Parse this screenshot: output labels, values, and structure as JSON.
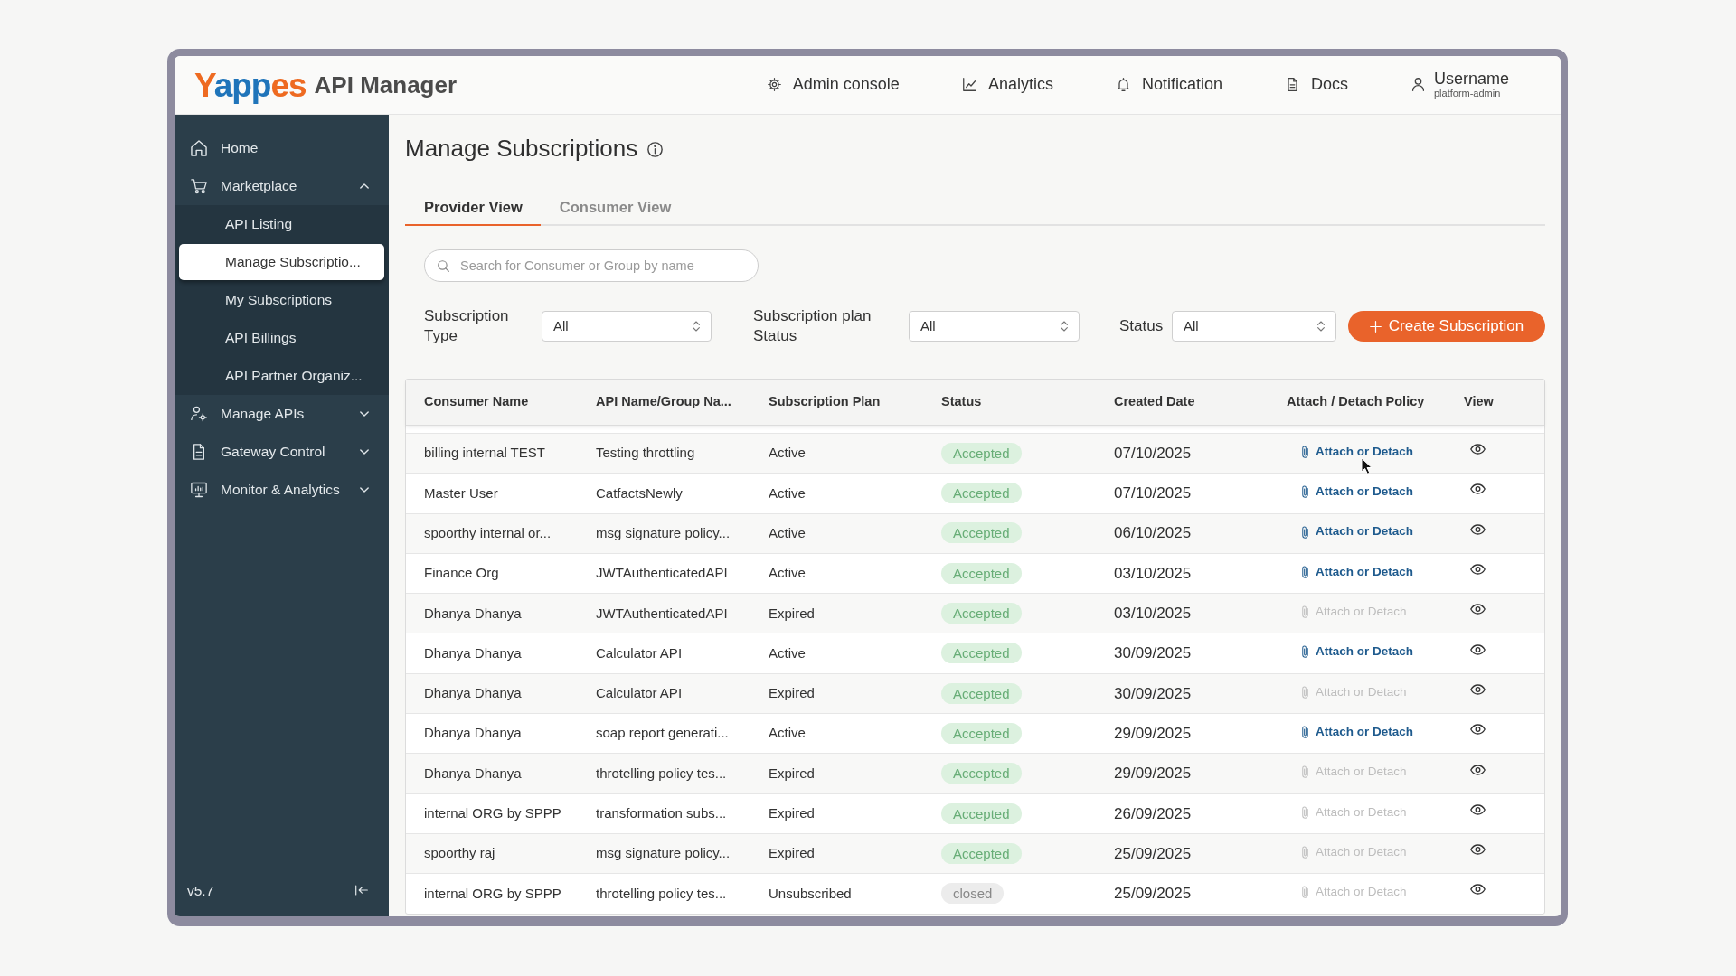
{
  "header": {
    "logo": "Yappes",
    "app_name": "API Manager",
    "nav": [
      {
        "label": "Admin console"
      },
      {
        "label": "Analytics"
      },
      {
        "label": "Notification"
      },
      {
        "label": "Docs"
      }
    ],
    "user": {
      "name": "Username",
      "role": "platform-admin"
    }
  },
  "sidebar": {
    "items": [
      {
        "label": "Home",
        "selected": false
      },
      {
        "label": "Marketplace",
        "selected": false,
        "expanded": true,
        "children": [
          {
            "label": "API Listing",
            "selected": false
          },
          {
            "label": "Manage Subscriptio...",
            "selected": true
          },
          {
            "label": "My Subscriptions",
            "selected": false
          },
          {
            "label": "API Billings",
            "selected": false
          },
          {
            "label": "API Partner Organiz...",
            "selected": false
          }
        ]
      },
      {
        "label": "Manage APIs",
        "selected": false,
        "expanded": false
      },
      {
        "label": "Gateway Control",
        "selected": false,
        "expanded": false
      },
      {
        "label": "Monitor & Analytics",
        "selected": false,
        "expanded": false
      }
    ],
    "version": "v5.7"
  },
  "page": {
    "title": "Manage Subscriptions",
    "tabs": [
      {
        "label": "Provider View",
        "selected": true
      },
      {
        "label": "Consumer View",
        "selected": false
      }
    ],
    "search": {
      "placeholder": "Search for Consumer or Group by name"
    },
    "filters": [
      {
        "label": "Subscription Type",
        "value": "All"
      },
      {
        "label": "Subscription plan Status",
        "value": "All"
      },
      {
        "label": "Status",
        "value": "All"
      }
    ],
    "create_button": {
      "label": "Create Subscription"
    }
  },
  "table": {
    "columns": [
      "Consumer Name",
      "API Name/Group Na...",
      "Subscription Plan",
      "Status",
      "Created Date",
      "Attach / Detach Policy",
      "View"
    ],
    "rows": [
      {
        "consumer_name": "billing internal TEST",
        "api_name": "Testing throttling",
        "subscription_plan": "Active",
        "status": {
          "label": "Accepted",
          "kind": "accepted"
        },
        "created_date": "07/10/2025",
        "policy_link": {
          "label": "Attach or Detach",
          "disabled": false
        }
      },
      {
        "consumer_name": "Master User",
        "api_name": "CatfactsNewly",
        "subscription_plan": "Active",
        "status": {
          "label": "Accepted",
          "kind": "accepted"
        },
        "created_date": "07/10/2025",
        "policy_link": {
          "label": "Attach or Detach",
          "disabled": false
        }
      },
      {
        "consumer_name": "spoorthy internal or...",
        "api_name": "msg signature policy...",
        "subscription_plan": "Active",
        "status": {
          "label": "Accepted",
          "kind": "accepted"
        },
        "created_date": "06/10/2025",
        "policy_link": {
          "label": "Attach or Detach",
          "disabled": false
        }
      },
      {
        "consumer_name": "Finance Org",
        "api_name": "JWTAuthenticatedAPI",
        "subscription_plan": "Active",
        "status": {
          "label": "Accepted",
          "kind": "accepted"
        },
        "created_date": "03/10/2025",
        "policy_link": {
          "label": "Attach or Detach",
          "disabled": false
        }
      },
      {
        "consumer_name": "Dhanya Dhanya",
        "api_name": "JWTAuthenticatedAPI",
        "subscription_plan": "Expired",
        "status": {
          "label": "Accepted",
          "kind": "accepted"
        },
        "created_date": "03/10/2025",
        "policy_link": {
          "label": "Attach or Detach",
          "disabled": true
        }
      },
      {
        "consumer_name": "Dhanya Dhanya",
        "api_name": "Calculator API",
        "subscription_plan": "Active",
        "status": {
          "label": "Accepted",
          "kind": "accepted"
        },
        "created_date": "30/09/2025",
        "policy_link": {
          "label": "Attach or Detach",
          "disabled": false
        }
      },
      {
        "consumer_name": "Dhanya Dhanya",
        "api_name": "Calculator API",
        "subscription_plan": "Expired",
        "status": {
          "label": "Accepted",
          "kind": "accepted"
        },
        "created_date": "30/09/2025",
        "policy_link": {
          "label": "Attach or Detach",
          "disabled": true
        }
      },
      {
        "consumer_name": "Dhanya Dhanya",
        "api_name": "soap report generati...",
        "subscription_plan": "Active",
        "status": {
          "label": "Accepted",
          "kind": "accepted"
        },
        "created_date": "29/09/2025",
        "policy_link": {
          "label": "Attach or Detach",
          "disabled": false
        }
      },
      {
        "consumer_name": "Dhanya Dhanya",
        "api_name": "throtelling policy tes...",
        "subscription_plan": "Expired",
        "status": {
          "label": "Accepted",
          "kind": "accepted"
        },
        "created_date": "29/09/2025",
        "policy_link": {
          "label": "Attach or Detach",
          "disabled": true
        }
      },
      {
        "consumer_name": "internal ORG by SPPP",
        "api_name": "transformation subs...",
        "subscription_plan": "Expired",
        "status": {
          "label": "Accepted",
          "kind": "accepted"
        },
        "created_date": "26/09/2025",
        "policy_link": {
          "label": "Attach or Detach",
          "disabled": true
        }
      },
      {
        "consumer_name": "spoorthy raj",
        "api_name": "msg signature policy...",
        "subscription_plan": "Expired",
        "status": {
          "label": "Accepted",
          "kind": "accepted"
        },
        "created_date": "25/09/2025",
        "policy_link": {
          "label": "Attach or Detach",
          "disabled": true
        }
      },
      {
        "consumer_name": "internal ORG by SPPP",
        "api_name": "throtelling policy tes...",
        "subscription_plan": "Unsubscribed",
        "status": {
          "label": "closed",
          "kind": "closed"
        },
        "created_date": "25/09/2025",
        "policy_link": {
          "label": "Attach or Detach",
          "disabled": true
        }
      }
    ]
  }
}
